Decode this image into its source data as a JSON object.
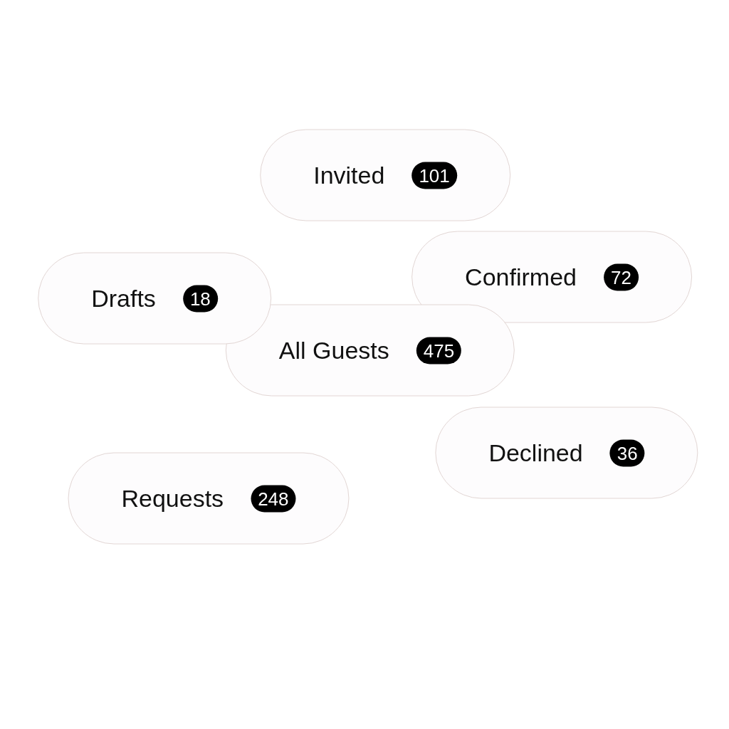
{
  "filters": [
    {
      "label": "Invited",
      "count": "101"
    },
    {
      "label": "Confirmed",
      "count": "72"
    },
    {
      "label": "Drafts",
      "count": "18"
    },
    {
      "label": "All Guests",
      "count": "475"
    },
    {
      "label": "Declined",
      "count": "36"
    },
    {
      "label": "Requests",
      "count": "248"
    }
  ]
}
